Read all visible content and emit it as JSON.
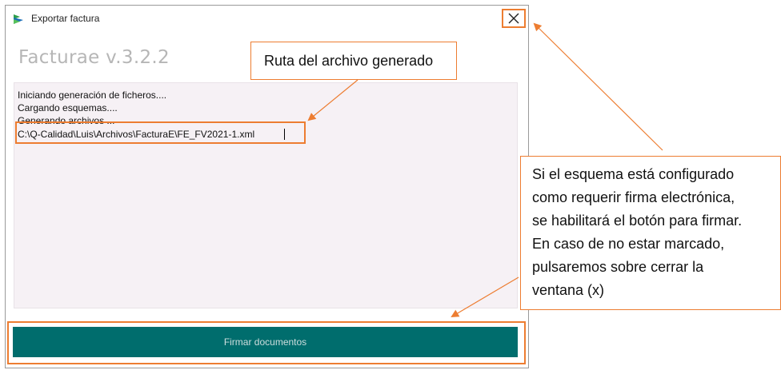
{
  "window": {
    "title": "Exportar factura",
    "app_title": "Facturae v.3.2.2",
    "log_lines": [
      "Iniciando generación de ficheros....",
      "Cargando esquemas....",
      "Generando archivos ..."
    ],
    "file_path": "C:\\Q-Calidad\\Luis\\Archivos\\FacturaE\\FE_FV2021-1.xml",
    "sign_button_label": "Firmar documentos",
    "close_glyph": "✕"
  },
  "annotations": {
    "path_callout": "Ruta del archivo generado",
    "sign_callout_lines": [
      "Si el esquema está configurado",
      "como requerir firma electrónica,",
      "se habilitará el botón para firmar.",
      "En caso de no estar marcado,",
      "pulsaremos sobre cerrar la",
      "ventana (x)"
    ]
  },
  "colors": {
    "accent_orange": "#ed7d31",
    "button_teal": "#006d6d",
    "log_background": "#f6f1f5"
  }
}
